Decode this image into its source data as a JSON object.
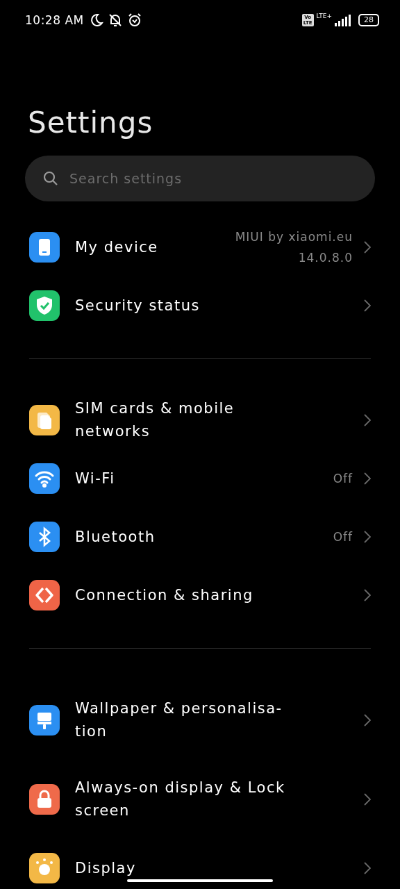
{
  "status_bar": {
    "time": "10:28 AM",
    "volte": [
      "Vo",
      "LTE"
    ],
    "network": "LTE+",
    "battery": "28"
  },
  "title": "Settings",
  "search": {
    "placeholder": "Search settings"
  },
  "groups": [
    {
      "items": [
        {
          "label": [
            "My device"
          ],
          "value": [
            "MIUI by xiaomi.eu",
            "14.0.8.0"
          ]
        },
        {
          "label": [
            "Security status"
          ]
        }
      ]
    },
    {
      "items": [
        {
          "label": [
            "SIM cards & mobile",
            "networks"
          ]
        },
        {
          "label": [
            "Wi-Fi"
          ],
          "value": [
            "Off"
          ]
        },
        {
          "label": [
            "Bluetooth"
          ],
          "value": [
            "Off"
          ]
        },
        {
          "label": [
            "Connection & sharing"
          ]
        }
      ]
    },
    {
      "items": [
        {
          "label": [
            "Wallpaper & personalisa-",
            "tion"
          ]
        },
        {
          "label": [
            "Always-on display & Lock",
            "screen"
          ]
        },
        {
          "label": [
            "Display"
          ]
        }
      ]
    }
  ]
}
